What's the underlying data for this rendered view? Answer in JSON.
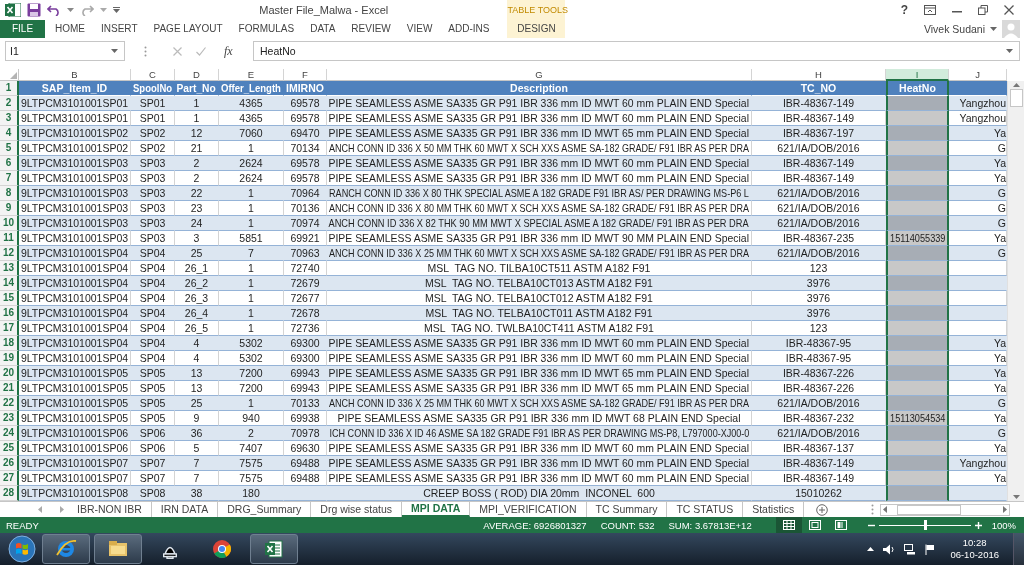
{
  "window": {
    "title": "Master File_Malwa - Excel",
    "help": "?",
    "user": "Vivek Sudani"
  },
  "ribbon": {
    "tabs": [
      {
        "label": "FILE",
        "kind": "file",
        "selected": false
      },
      {
        "label": "HOME",
        "kind": "tab",
        "selected": false
      },
      {
        "label": "INSERT",
        "kind": "tab",
        "selected": false
      },
      {
        "label": "PAGE LAYOUT",
        "kind": "tab",
        "selected": false
      },
      {
        "label": "FORMULAS",
        "kind": "tab",
        "selected": false
      },
      {
        "label": "DATA",
        "kind": "tab",
        "selected": false
      },
      {
        "label": "REVIEW",
        "kind": "tab",
        "selected": false
      },
      {
        "label": "VIEW",
        "kind": "tab",
        "selected": false
      },
      {
        "label": "ADD-INS",
        "kind": "tab",
        "selected": false
      }
    ],
    "contextual": {
      "group": "TABLE TOOLS",
      "tabs": [
        {
          "label": "DESIGN",
          "selected": false
        }
      ]
    }
  },
  "formula_bar": {
    "name_box": "I1",
    "fx": "fx",
    "formula": "HeatNo"
  },
  "sheet": {
    "header_row": "1",
    "columns": [
      {
        "letter": "B",
        "title": "SAP_Item_ID",
        "selected": false
      },
      {
        "letter": "C",
        "title": "SpoolNo",
        "selected": false
      },
      {
        "letter": "D",
        "title": "Part_No",
        "selected": false
      },
      {
        "letter": "E",
        "title": "Offer_Length",
        "selected": false
      },
      {
        "letter": "F",
        "title": "IMIRNO",
        "selected": false
      },
      {
        "letter": "G",
        "title": "Description",
        "selected": false
      },
      {
        "letter": "H",
        "title": "TC_NO",
        "selected": false
      },
      {
        "letter": "I",
        "title": "HeatNo",
        "selected": true
      },
      {
        "letter": "J",
        "selected": false
      }
    ],
    "rows": [
      {
        "number": "2",
        "cells": {
          "B": "9LTPCM3101001SP01",
          "C": "SP01",
          "D": "1",
          "E": "4365",
          "F": "69578",
          "G": "PIPE SEAMLESS ASME SA335 GR P91 IBR 336 mm ID MWT 60 mm PLAIN END Special",
          "H": "IBR-48367-149",
          "J": "Yangzhou"
        }
      },
      {
        "number": "3",
        "cells": {
          "B": "9LTPCM3101001SP01",
          "C": "SP01",
          "D": "1",
          "E": "4365",
          "F": "69578",
          "G": "PIPE SEAMLESS ASME SA335 GR P91 IBR 336 mm ID MWT 60 mm PLAIN END Special",
          "H": "IBR-48367-149",
          "J": "Yangzhou"
        }
      },
      {
        "number": "4",
        "cells": {
          "B": "9LTPCM3101001SP02",
          "C": "SP02",
          "D": "12",
          "E": "7060",
          "F": "69470",
          "G": "PIPE SEAMLESS ASME SA335 GR P91 IBR 336 mm ID MWT 65 mm PLAIN END Special",
          "H": "IBR-48367-197",
          "J": "Ya"
        }
      },
      {
        "number": "5",
        "cells": {
          "B": "9LTPCM3101001SP02",
          "C": "SP02",
          "D": "21",
          "E": "1",
          "F": "70134",
          "G": "ANCH CONN ID 336 X 50 MM THK 60 MWT X SCH XXS ASME SA-182 GRADE/ F91 IBR AS PER DRA",
          "H": "621/IA/DOB/2016",
          "J": "G"
        }
      },
      {
        "number": "6",
        "cells": {
          "B": "9LTPCM3101001SP03",
          "C": "SP03",
          "D": "2",
          "E": "2624",
          "F": "69578",
          "G": "PIPE SEAMLESS ASME SA335 GR P91 IBR 336 mm ID MWT 60 mm PLAIN END Special",
          "H": "IBR-48367-149",
          "J": "Ya"
        }
      },
      {
        "number": "7",
        "cells": {
          "B": "9LTPCM3101001SP03",
          "C": "SP03",
          "D": "2",
          "E": "2624",
          "F": "69578",
          "G": "PIPE SEAMLESS ASME SA335 GR P91 IBR 336 mm ID MWT 60 mm PLAIN END Special",
          "H": "IBR-48367-149",
          "J": "Ya"
        }
      },
      {
        "number": "8",
        "cells": {
          "B": "9LTPCM3101001SP03",
          "C": "SP03",
          "D": "22",
          "E": "1",
          "F": "70964",
          "G": "RANCH CONN ID 336 X 80 THK SPECIAL ASME A 182 GRADE F91 IBR AS/ PER DRAWING MS-P6 L",
          "H": "621/IA/DOB/2016",
          "J": "G"
        }
      },
      {
        "number": "9",
        "cells": {
          "B": "9LTPCM3101001SP03",
          "C": "SP03",
          "D": "23",
          "E": "1",
          "F": "70136",
          "G": "ANCH CONN ID 336 X 80 MM THK 60 MWT X SCH XXS ASME SA-182 GRADE/ F91 IBR AS PER DRA",
          "H": "621/IA/DOB/2016",
          "J": "G"
        }
      },
      {
        "number": "10",
        "cells": {
          "B": "9LTPCM3101001SP03",
          "C": "SP03",
          "D": "24",
          "E": "1",
          "F": "70974",
          "G": "ANCH CONN ID 336 X 82 THK 90 MM MWT X SPECIAL ASME A 182 GRADE/ F91 IBR AS PER DRA",
          "H": "621/IA/DOB/2016",
          "J": "G"
        }
      },
      {
        "number": "11",
        "cells": {
          "B": "9LTPCM3101001SP03",
          "C": "SP03",
          "D": "3",
          "E": "5851",
          "F": "69921",
          "G": "PIPE SEAMLESS ASME SA335 GR P91 IBR 336 mm ID MWT 90 MM PLAIN END Special",
          "H": "IBR-48367-235",
          "I": "15114055339",
          "J": "Ya"
        }
      },
      {
        "number": "12",
        "cells": {
          "B": "9LTPCM3101001SP04",
          "C": "SP04",
          "D": "25",
          "E": "7",
          "F": "70963",
          "G": "ANCH CONN ID 336 X 25 MM THK 60 MWT X SCH XXS ASME SA-182 GRADE/ F91 IBR AS PER DRA",
          "H": "621/IA/DOB/2016",
          "J": "G"
        }
      },
      {
        "number": "13",
        "cells": {
          "B": "9LTPCM3101001SP04",
          "C": "SP04",
          "D": "26_1",
          "E": "1",
          "F": "72740",
          "G": "MSL  TAG NO. TILBA10CT511 ASTM A182 F91",
          "H": "123"
        }
      },
      {
        "number": "14",
        "cells": {
          "B": "9LTPCM3101001SP04",
          "C": "SP04",
          "D": "26_2",
          "E": "1",
          "F": "72679",
          "G": "MSL  TAG NO. TELBA10CT013 ASTM A182 F91",
          "H": "3976"
        }
      },
      {
        "number": "15",
        "cells": {
          "B": "9LTPCM3101001SP04",
          "C": "SP04",
          "D": "26_3",
          "E": "1",
          "F": "72677",
          "G": "MSL  TAG NO. TELBA10CT012 ASTM A182 F91",
          "H": "3976"
        }
      },
      {
        "number": "16",
        "cells": {
          "B": "9LTPCM3101001SP04",
          "C": "SP04",
          "D": "26_4",
          "E": "1",
          "F": "72678",
          "G": "MSL  TAG NO. TELBA10CT011 ASTM A182 F91",
          "H": "3976"
        }
      },
      {
        "number": "17",
        "cells": {
          "B": "9LTPCM3101001SP04",
          "C": "SP04",
          "D": "26_5",
          "E": "1",
          "F": "72736",
          "G": "MSL  TAG NO. TWLBA10CT411 ASTM A182 F91",
          "H": "123"
        }
      },
      {
        "number": "18",
        "cells": {
          "B": "9LTPCM3101001SP04",
          "C": "SP04",
          "D": "4",
          "E": "5302",
          "F": "69300",
          "G": "PIPE SEAMLESS ASME SA335 GR P91 IBR 336 mm ID MWT 60 mm PLAIN END Special",
          "H": "IBR-48367-95",
          "J": "Ya"
        }
      },
      {
        "number": "19",
        "cells": {
          "B": "9LTPCM3101001SP04",
          "C": "SP04",
          "D": "4",
          "E": "5302",
          "F": "69300",
          "G": "PIPE SEAMLESS ASME SA335 GR P91 IBR 336 mm ID MWT 60 mm PLAIN END Special",
          "H": "IBR-48367-95",
          "J": "Ya"
        }
      },
      {
        "number": "20",
        "cells": {
          "B": "9LTPCM3101001SP05",
          "C": "SP05",
          "D": "13",
          "E": "7200",
          "F": "69943",
          "G": "PIPE SEAMLESS ASME SA335 GR P91 IBR 336 mm ID MWT 65 mm PLAIN END Special",
          "H": "IBR-48367-226",
          "J": "Ya"
        }
      },
      {
        "number": "21",
        "cells": {
          "B": "9LTPCM3101001SP05",
          "C": "SP05",
          "D": "13",
          "E": "7200",
          "F": "69943",
          "G": "PIPE SEAMLESS ASME SA335 GR P91 IBR 336 mm ID MWT 65 mm PLAIN END Special",
          "H": "IBR-48367-226",
          "J": "Ya"
        }
      },
      {
        "number": "22",
        "cells": {
          "B": "9LTPCM3101001SP05",
          "C": "SP05",
          "D": "25",
          "E": "1",
          "F": "70133",
          "G": "ANCH CONN ID 336 X 25 MM THK 60 MWT X SCH XXS ASME SA-182 GRADE/ F91 IBR AS PER DRA",
          "H": "621/IA/DOB/2016",
          "J": "G"
        }
      },
      {
        "number": "23",
        "cells": {
          "B": "9LTPCM3101001SP05",
          "C": "SP05",
          "D": "9",
          "E": "940",
          "F": "69938",
          "G": "PIPE SEAMLESS ASME SA335 GR P91 IBR 336 mm ID MWT 68 PLAIN END Special",
          "H": "IBR-48367-232",
          "I": "15113054534",
          "J": "Ya"
        }
      },
      {
        "number": "24",
        "cells": {
          "B": "9LTPCM3101001SP06",
          "C": "SP06",
          "D": "36",
          "E": "2",
          "F": "70978",
          "G": "ICH CONN ID 336 X ID 46 ASME SA 182 GRADE F91 IBR AS PER DRAWING MS-P8, L797000-XJ00-0",
          "H": "621/IA/DOB/2016",
          "J": "G"
        }
      },
      {
        "number": "25",
        "cells": {
          "B": "9LTPCM3101001SP06",
          "C": "SP06",
          "D": "5",
          "E": "7407",
          "F": "69630",
          "G": "PIPE SEAMLESS ASME SA335 GR P91 IBR 336 mm ID MWT 60 mm PLAIN END Special",
          "H": "IBR-48367-137",
          "J": "Ya"
        }
      },
      {
        "number": "26",
        "cells": {
          "B": "9LTPCM3101001SP07",
          "C": "SP07",
          "D": "7",
          "E": "7575",
          "F": "69488",
          "G": "PIPE SEAMLESS ASME SA335 GR P91 IBR 336 mm ID MWT 60 mm PLAIN END Special",
          "H": "IBR-48367-149",
          "J": "Yangzhou"
        }
      },
      {
        "number": "27",
        "cells": {
          "B": "9LTPCM3101001SP07",
          "C": "SP07",
          "D": "7",
          "E": "7575",
          "F": "69488",
          "G": "PIPE SEAMLESS ASME SA335 GR P91 IBR 336 mm ID MWT 60 mm PLAIN END Special",
          "H": "IBR-48367-149",
          "J": "Ya"
        }
      },
      {
        "number": "28",
        "cells": {
          "B": "9LTPCM3101001SP08",
          "C": "SP08",
          "D": "38",
          "E": "180",
          "G": "CREEP BOSS ( ROD) DIA 20mm  INCONEL  600",
          "H": "15010262"
        }
      }
    ]
  },
  "sheet_tabs": [
    {
      "label": "IBR-NON IBR",
      "selected": false
    },
    {
      "label": "IRN DATA",
      "selected": false
    },
    {
      "label": "DRG_Summary",
      "selected": false
    },
    {
      "label": "Drg wise status",
      "selected": false
    },
    {
      "label": "MPI DATA",
      "selected": true
    },
    {
      "label": "MPI_VERIFICATION",
      "selected": false
    },
    {
      "label": "TC Summary",
      "selected": false
    },
    {
      "label": "TC STATUS",
      "selected": false
    },
    {
      "label": "Statistics",
      "selected": false
    }
  ],
  "status_bar": {
    "mode": "READY",
    "average": "AVERAGE: 6926801327",
    "count": "COUNT: 532",
    "sum": "SUM: 3.67813E+12",
    "views": [
      {
        "kind": "normal",
        "selected": true
      },
      {
        "kind": "page_layout",
        "selected": false
      },
      {
        "kind": "page_break",
        "selected": false
      }
    ],
    "zoom": {
      "level": 0.5,
      "reading": "100%"
    }
  },
  "taskbar": {
    "time": "10:28",
    "date": "06-10-2016"
  }
}
